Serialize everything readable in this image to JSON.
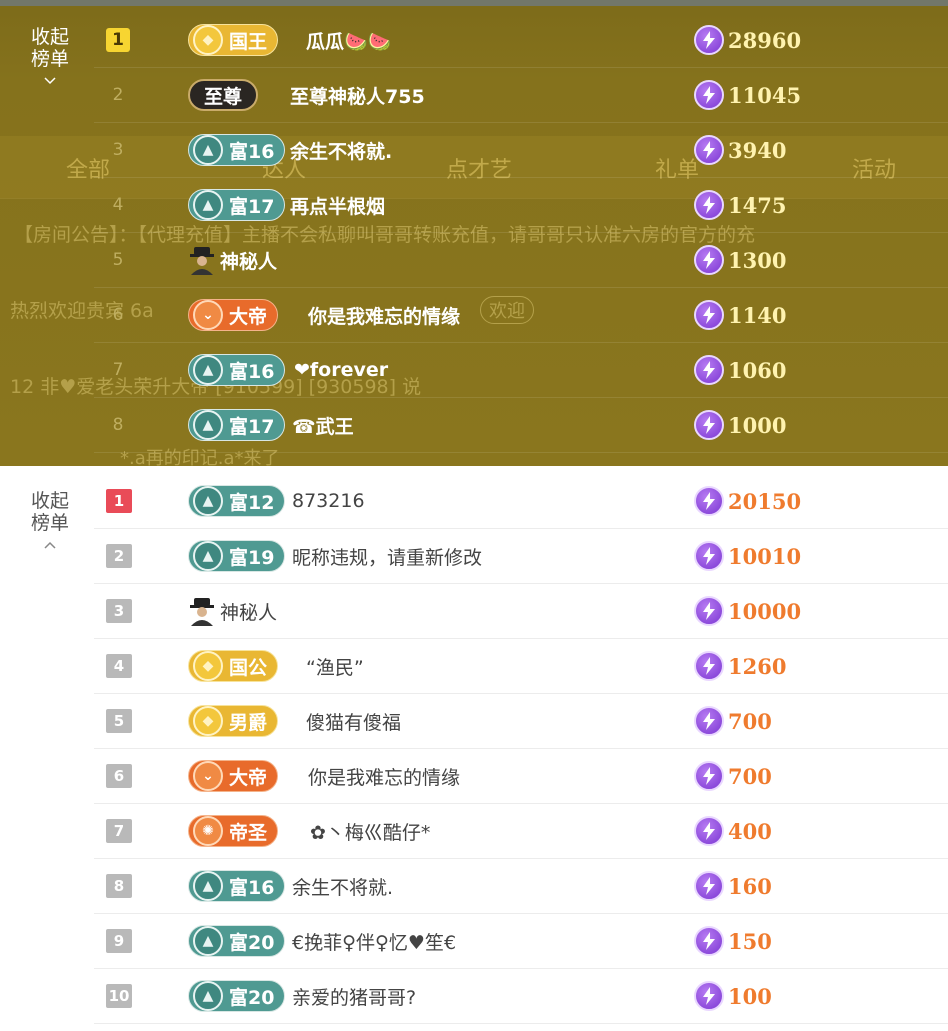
{
  "overlay": {
    "collapse_label_line1": "收起",
    "collapse_label_line2": "榜单",
    "ghost": {
      "tab_all": "全部",
      "tab_2": "达人",
      "tab_3": "点才艺",
      "tab_4": "礼单",
      "tab_5": "活动",
      "notice": "【房间公告】：【代理充值】主播不会私聊叫哥哥转账充值，请哥哥只认准六房的官方的充",
      "welcome": "热烈欢迎贵宾 6a",
      "welcome_btn": "欢迎",
      "marquee": "12 非♥爱老头荣升大帝 [910599] [930598] 说",
      "bottom": "*.a再的印记.a*来了"
    },
    "rows": [
      {
        "rank": "1",
        "badge": "国王",
        "name": "瓜瓜🍉🍉",
        "score": "28960"
      },
      {
        "rank": "2",
        "badge": "至尊",
        "name": "至尊神秘人755",
        "score": "11045"
      },
      {
        "rank": "3",
        "badge": "富16",
        "name": "余生不将就.",
        "score": "3940"
      },
      {
        "rank": "4",
        "badge": "富17",
        "name": "再点半根烟",
        "score": "1475"
      },
      {
        "rank": "5",
        "badge": "",
        "name": "神秘人",
        "score": "1300"
      },
      {
        "rank": "6",
        "badge": "大帝",
        "name": "你是我难忘的情缘",
        "score": "1140"
      },
      {
        "rank": "7",
        "badge": "富16",
        "name": "❤forever",
        "score": "1060"
      },
      {
        "rank": "8",
        "badge": "富17",
        "name": "☎武王",
        "score": "1000"
      }
    ]
  },
  "panel": {
    "collapse_label_line1": "收起",
    "collapse_label_line2": "榜单",
    "rows": [
      {
        "rank": "1",
        "badge": "富12",
        "name": "873216",
        "score": "20150"
      },
      {
        "rank": "2",
        "badge": "富19",
        "name": "昵称违规，请重新修改",
        "score": "10010"
      },
      {
        "rank": "3",
        "badge": "",
        "name": "神秘人",
        "score": "10000"
      },
      {
        "rank": "4",
        "badge": "国公",
        "name": "“渔民”",
        "score": "1260"
      },
      {
        "rank": "5",
        "badge": "男爵",
        "name": "傻猫有傻福",
        "score": "700"
      },
      {
        "rank": "6",
        "badge": "大帝",
        "name": "你是我难忘的情缘",
        "score": "700"
      },
      {
        "rank": "7",
        "badge": "帝圣",
        "name": "✿丶梅巛酷仔*",
        "score": "400"
      },
      {
        "rank": "8",
        "badge": "富16",
        "name": "余生不将就.",
        "score": "160"
      },
      {
        "rank": "9",
        "badge": "富20",
        "name": "€挽菲♀伴♀忆♥笙€",
        "score": "150"
      },
      {
        "rank": "10",
        "badge": "富20",
        "name": "亲爱的猪哥哥?",
        "score": "100"
      }
    ]
  },
  "colors": {
    "overlay_bg": "#85721c",
    "score_top": "#fff3b0",
    "score_bottom": "#ef7b2e",
    "rank_first_top": "#f7d531",
    "rank_first_bottom": "#e94b58",
    "badge_teal": "#4f9a92",
    "badge_gold": "#e9b733",
    "badge_orange": "#e86b2b"
  },
  "icons": {
    "score": "lightning-coin-icon",
    "mystery": "mystery-user-icon",
    "collapse_top": "chevron-down-icon",
    "collapse_bottom": "chevron-up-icon"
  }
}
